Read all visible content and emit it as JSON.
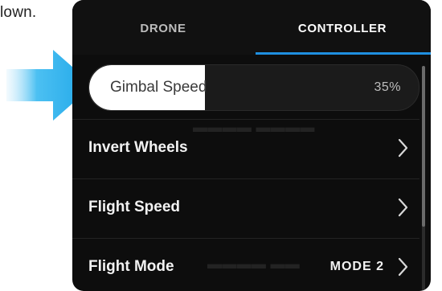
{
  "caption": "lown.",
  "tabs": [
    {
      "label": "DRONE",
      "active": false
    },
    {
      "label": "CONTROLLER",
      "active": true
    }
  ],
  "slider": {
    "label": "Gimbal Speed",
    "value_text": "35%",
    "value": 0.35
  },
  "rows": [
    {
      "label": "Invert Wheels",
      "value": ""
    },
    {
      "label": "Flight Speed",
      "value": ""
    },
    {
      "label": "Flight Mode",
      "value": "MODE 2"
    }
  ],
  "colors": {
    "accent": "#1f8fe0",
    "arrow": "#1ea6e8",
    "panel_bg": "#0d0d0d"
  }
}
